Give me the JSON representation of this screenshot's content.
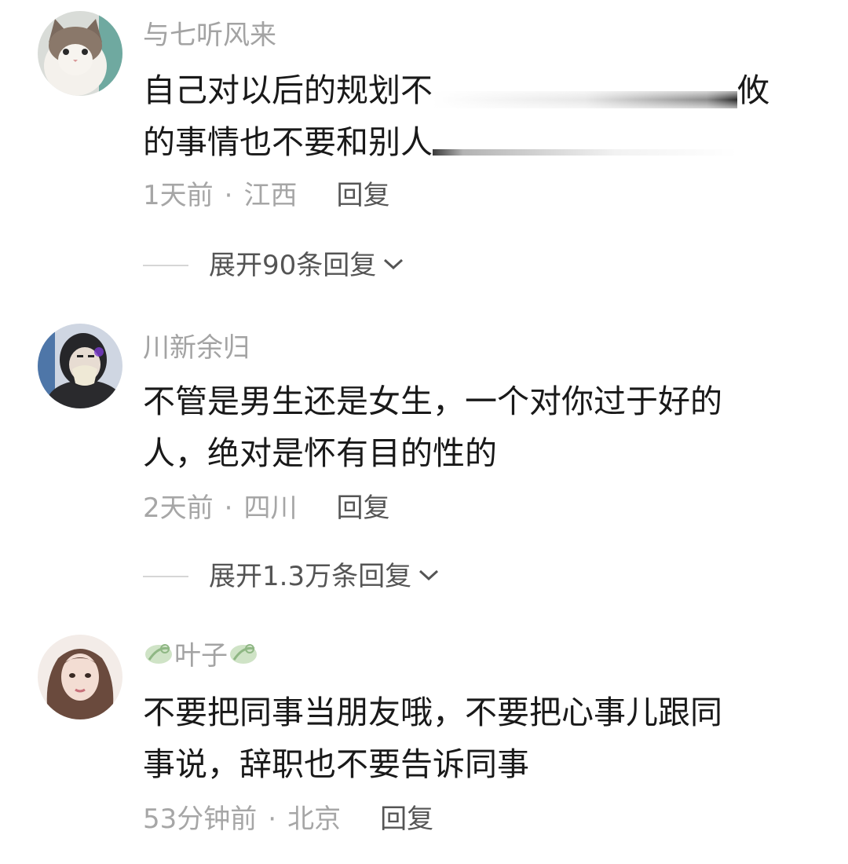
{
  "comments": [
    {
      "username": "与七听风来",
      "lines": [
        "自己对以后的规划不",
        "的事情也不要和别人"
      ],
      "line1_tail": "攸",
      "time": "1天前",
      "location": "江西",
      "reply": "回复",
      "expand": "展开90条回复"
    },
    {
      "username": "川新余归",
      "lines": [
        "不管是男生还是女生，一个对你过于好的",
        "人，绝对是怀有目的性的"
      ],
      "time": "2天前",
      "location": "四川",
      "reply": "回复",
      "expand": "展开1.3万条回复"
    },
    {
      "username": "叶子",
      "lines": [
        "不要把同事当朋友哦，不要把心事儿跟同",
        "事说，辞职也不要告诉同事"
      ],
      "time": "53分钟前",
      "location": "北京",
      "reply": "回复"
    }
  ],
  "separator": "·",
  "icons": {
    "avatar_1": "cat-avatar",
    "avatar_2": "masked-person-avatar",
    "avatar_3": "woman-avatar",
    "expand": "chevron-down-icon",
    "badge": "leaf-badge-icon"
  }
}
